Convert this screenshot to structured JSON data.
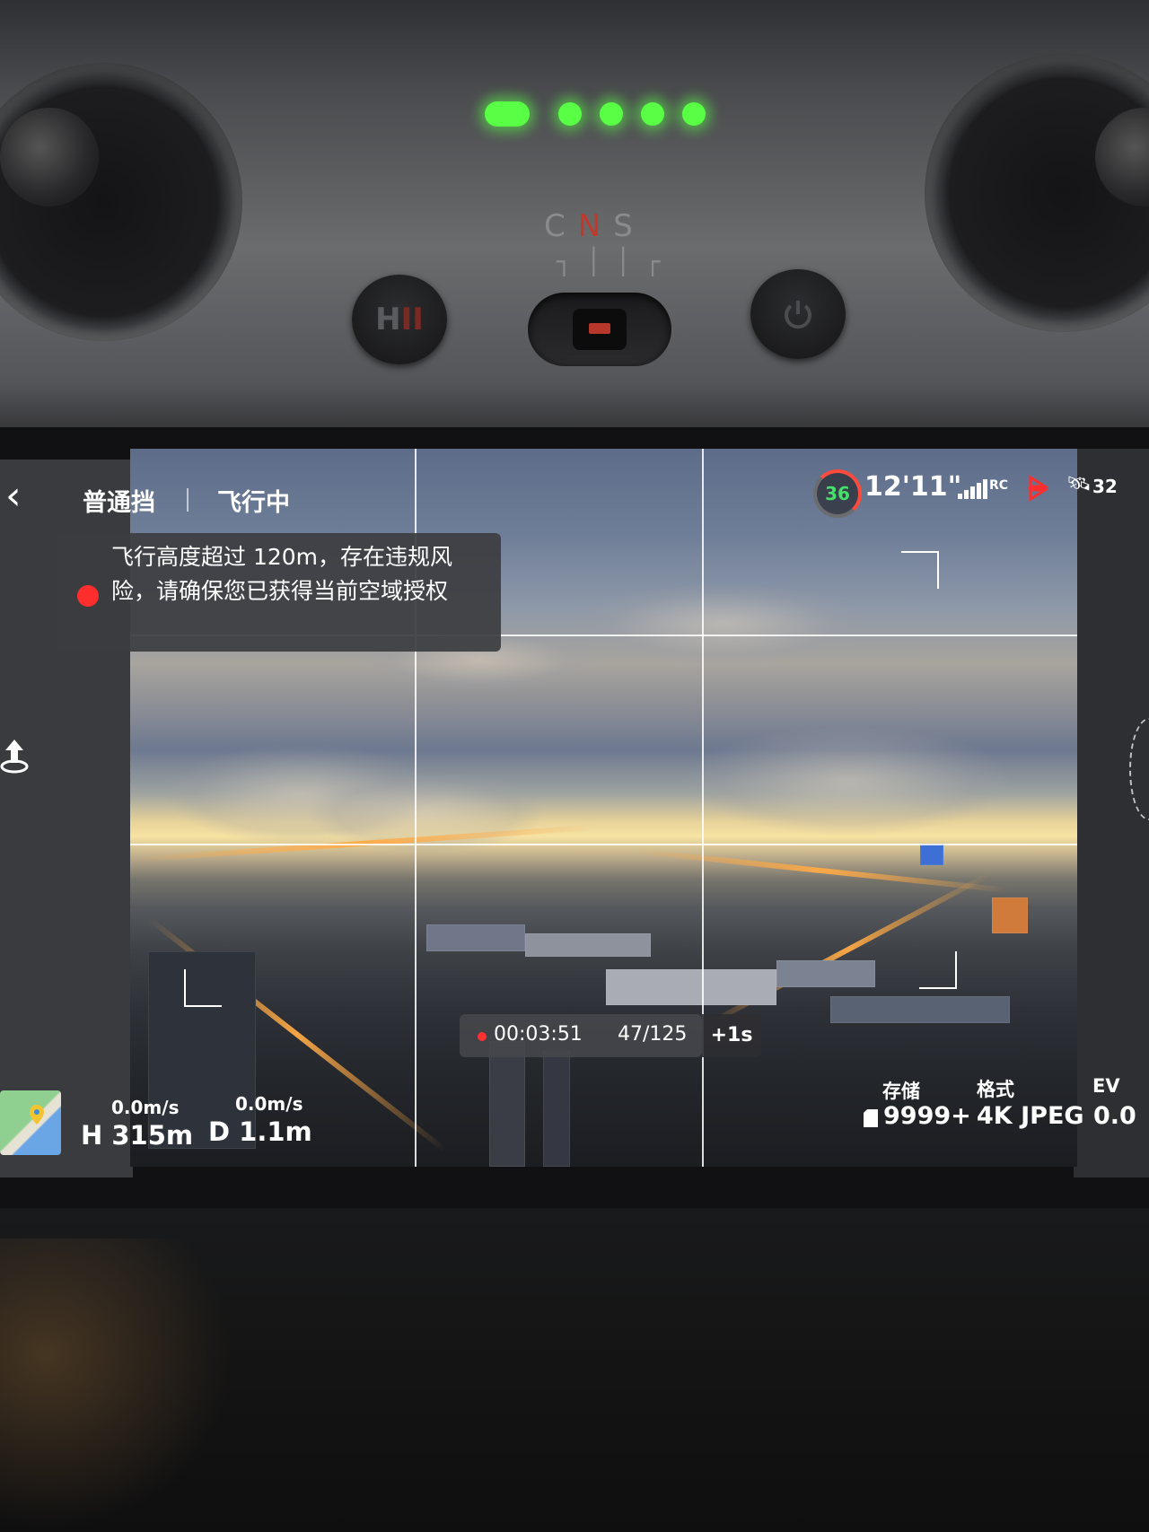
{
  "controller": {
    "led_count": 5,
    "mode_labels": [
      "C",
      "N",
      "S"
    ],
    "mode_ticks": "┐││┌",
    "hl_label": [
      "H",
      "II"
    ],
    "power_icon": "power-icon"
  },
  "top_bar": {
    "back_icon": "‹",
    "gear_mode": "普通挡",
    "flight_status": "飞行中",
    "battery_percent": "36",
    "flight_time": "12'11\"",
    "rc_label": "RC",
    "satellite_count": "32"
  },
  "warning": {
    "text": "飞行高度超过 120m，存在违规风险，请确保您已获得当前空域授权"
  },
  "telemetry": {
    "h_speed": "0.0m/s",
    "v_speed": "0.0m/s",
    "height": "H 315m",
    "distance": "D 1.1m"
  },
  "recording": {
    "elapsed": "00:03:51",
    "photo_count": "47/125",
    "interval": "+1s"
  },
  "camera_info": {
    "storage_label": "存储",
    "storage_value": "9999+",
    "format_label": "格式",
    "format_value": "4K JPEG",
    "ev_label": "EV",
    "ev_value": "0.0"
  },
  "colors": {
    "battery_green": "#47e06a",
    "warning_red": "#ff2e2e",
    "led_green": "#59ff45"
  }
}
